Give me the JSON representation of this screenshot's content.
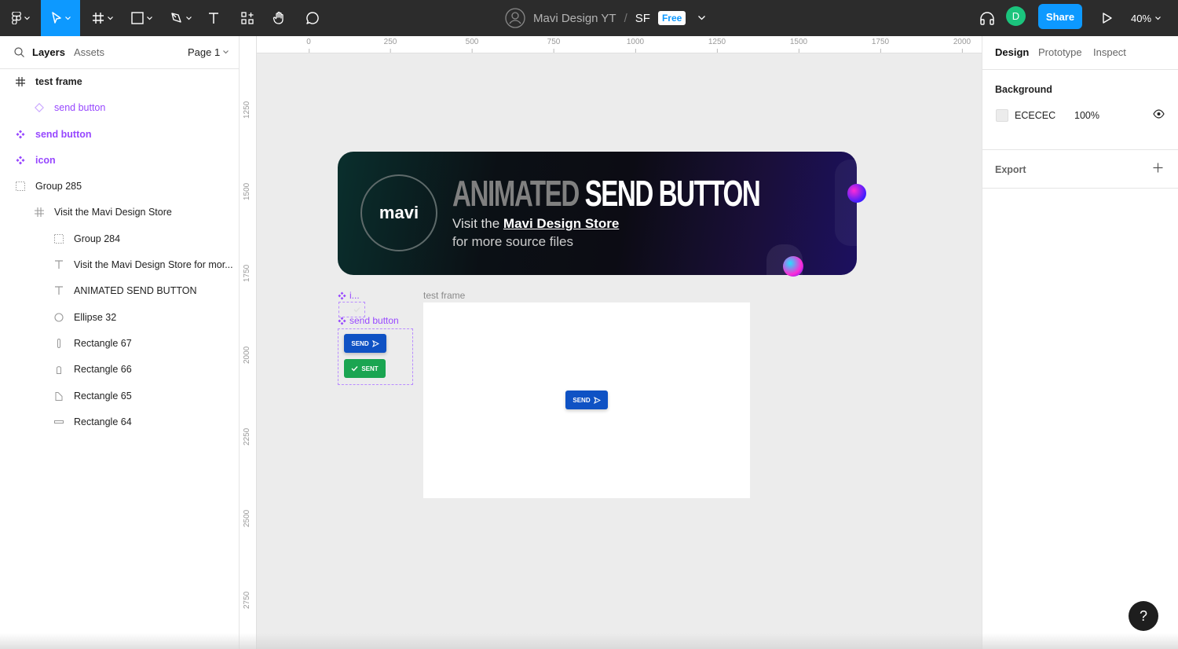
{
  "toolbar": {
    "team": "Mavi Design YT",
    "separator": "/",
    "file": "SF",
    "plan_badge": "Free",
    "user_initial": "D",
    "share_label": "Share",
    "zoom": "40%",
    "accent": "#0d99ff"
  },
  "left_panel": {
    "tab_layers": "Layers",
    "tab_assets": "Assets",
    "page": "Page 1",
    "layers": [
      {
        "label": "test frame",
        "icon": "frame-icon"
      },
      {
        "label": "send button",
        "icon": "instance-icon"
      },
      {
        "label": "send button",
        "icon": "component-icon"
      },
      {
        "label": "icon",
        "icon": "component-icon"
      },
      {
        "label": "Group 285",
        "icon": "group-icon"
      },
      {
        "label": "Visit the Mavi Design Store",
        "icon": "frame-icon"
      },
      {
        "label": "Group 284",
        "icon": "group-icon"
      },
      {
        "label": "Visit the Mavi Design Store for mor...",
        "icon": "text-icon"
      },
      {
        "label": "ANIMATED SEND BUTTON",
        "icon": "text-icon"
      },
      {
        "label": "Ellipse 32",
        "icon": "ellipse-icon"
      },
      {
        "label": "Rectangle 67",
        "icon": "rectangle-icon"
      },
      {
        "label": "Rectangle 66",
        "icon": "rectangle-icon"
      },
      {
        "label": "Rectangle 65",
        "icon": "rectangle-icon"
      },
      {
        "label": "Rectangle 64",
        "icon": "rectangle-icon"
      }
    ]
  },
  "canvas": {
    "ruler_x": [
      "0",
      "250",
      "500",
      "750",
      "1000",
      "1250",
      "1500",
      "1750",
      "2000"
    ],
    "ruler_y": [
      "1250",
      "1500",
      "1750",
      "2000",
      "2250",
      "2500",
      "2750"
    ],
    "banner": {
      "logo": "mavi",
      "headline_dim": "ANIMATED",
      "headline_bright": "SEND BUTTON",
      "sub_prefix": "Visit the",
      "sub_link": "Mavi Design Store",
      "sub_line2": "for more source files"
    },
    "icon_component_label": "i...",
    "send_component_label": "send button",
    "send_label": "SEND",
    "sent_label": "SENT",
    "frame_label": "test frame"
  },
  "right_panel": {
    "tab_design": "Design",
    "tab_prototype": "Prototype",
    "tab_inspect": "Inspect",
    "background_title": "Background",
    "background_hex": "ECECEC",
    "background_opacity": "100%",
    "export_title": "Export"
  },
  "help": "?"
}
